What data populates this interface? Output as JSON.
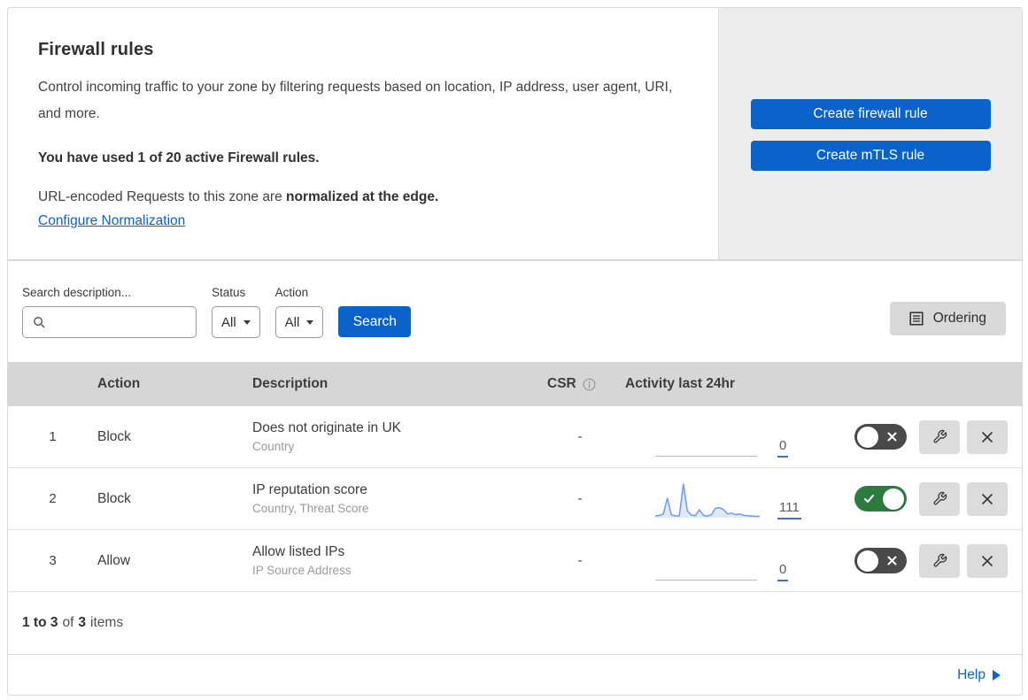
{
  "header": {
    "title": "Firewall rules",
    "description": "Control incoming traffic to your zone by filtering requests based on location, IP address, user agent, URI, and more.",
    "usage_note": "You have used 1 of 20 active Firewall rules.",
    "normalization_text": "URL-encoded Requests to this zone are",
    "normalization_bold": "normalized at the edge.",
    "normalization_link": "Configure Normalization"
  },
  "actions_panel": {
    "create_firewall_label": "Create firewall rule",
    "create_mtls_label": "Create mTLS rule"
  },
  "filters": {
    "search_label": "Search description...",
    "search_value": "",
    "status_label": "Status",
    "status_value": "All",
    "action_label": "Action",
    "action_value": "All",
    "search_button_label": "Search",
    "ordering_button_label": "Ordering"
  },
  "table": {
    "headers": {
      "action": "Action",
      "description": "Description",
      "csr": "CSR",
      "activity": "Activity last 24hr"
    },
    "rows": [
      {
        "priority": "1",
        "action": "Block",
        "description": "Does not originate in UK",
        "fields": "Country",
        "csr": "-",
        "activity_count": "0",
        "enabled": false,
        "sparkline": []
      },
      {
        "priority": "2",
        "action": "Block",
        "description": "IP reputation score",
        "fields": "Country, Threat Score",
        "csr": "-",
        "activity_count": "111",
        "enabled": true,
        "sparkline": [
          5,
          7,
          10,
          58,
          9,
          5,
          6,
          100,
          20,
          8,
          6,
          24,
          7,
          5,
          9,
          28,
          30,
          24,
          11,
          14,
          9,
          11,
          7,
          6,
          5,
          4,
          4
        ]
      },
      {
        "priority": "3",
        "action": "Allow",
        "description": "Allow listed IPs",
        "fields": "IP Source Address",
        "csr": "-",
        "activity_count": "0",
        "enabled": false,
        "sparkline": []
      }
    ]
  },
  "pagination": {
    "range": "1 to 3",
    "of_label": "of",
    "total": "3",
    "items_label": "items"
  },
  "help": {
    "label": "Help"
  },
  "colors": {
    "primary_blue": "#0b62cb",
    "link_blue": "#0b62cb",
    "toggle_on_green": "#2e7b40",
    "toggle_off_gray": "#4a4a4a",
    "actions_panel_gray": "#ededed",
    "table_header_gray": "#d6d6d6",
    "gray_button": "#d9d9d9",
    "sparkline_blue": "#6d9ce8"
  }
}
